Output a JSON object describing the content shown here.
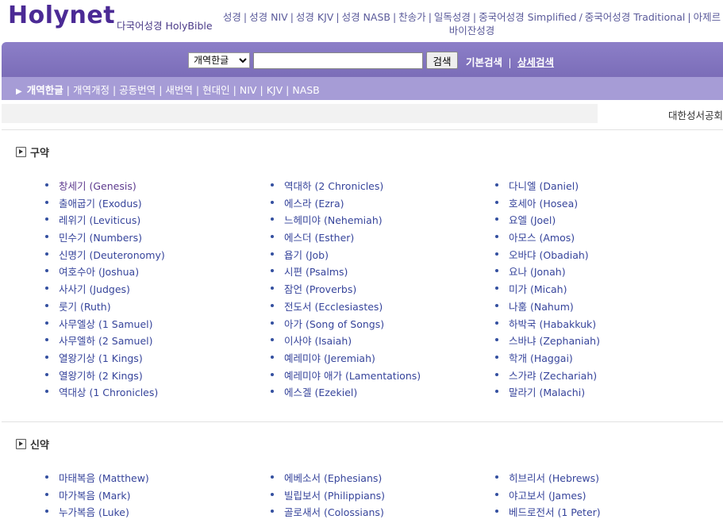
{
  "header": {
    "logo": "Holynet",
    "subtitle": "다국어성경 HolyBible",
    "nav": [
      "성경",
      "성경 NIV",
      "성경 KJV",
      "성경 NASB",
      "찬송가",
      "일독성경",
      "중국어성경 Simplified",
      "중국어성경 Traditional",
      "아제르바이잔성경"
    ]
  },
  "search": {
    "version_selected": "개역한글",
    "input_value": "",
    "button_label": "검색",
    "basic_label": "기본검색",
    "advanced_label": "상세검색"
  },
  "versions": {
    "active": "개역한글",
    "others": [
      "개역개정",
      "공동번역",
      "새번역",
      "현대인",
      "NIV",
      "KJV",
      "NASB"
    ]
  },
  "publisher": "대한성서공회",
  "old_testament": {
    "title": "구약",
    "columns": [
      [
        "창세기 (Genesis)",
        "출애굽기 (Exodus)",
        "레위기 (Leviticus)",
        "민수기 (Numbers)",
        "신명기 (Deuteronomy)",
        "여호수아 (Joshua)",
        "사사기 (Judges)",
        "룻기 (Ruth)",
        "사무엘상 (1 Samuel)",
        "사무엘하 (2 Samuel)",
        "열왕기상 (1 Kings)",
        "열왕기하 (2 Kings)",
        "역대상 (1 Chronicles)"
      ],
      [
        "역대하 (2 Chronicles)",
        "에스라 (Ezra)",
        "느헤미야 (Nehemiah)",
        "에스더 (Esther)",
        "욥기 (Job)",
        "시편 (Psalms)",
        "잠언 (Proverbs)",
        "전도서 (Ecclesiastes)",
        "아가 (Song of Songs)",
        "이사야 (Isaiah)",
        "예레미야 (Jeremiah)",
        "예레미야 애가 (Lamentations)",
        "에스겔 (Ezekiel)"
      ],
      [
        "다니엘 (Daniel)",
        "호세아 (Hosea)",
        "요엘 (Joel)",
        "아모스 (Amos)",
        "오바댜 (Obadiah)",
        "요나 (Jonah)",
        "미가 (Micah)",
        "나훔 (Nahum)",
        "하박국 (Habakkuk)",
        "스바냐 (Zephaniah)",
        "학개 (Haggai)",
        "스가랴 (Zechariah)",
        "말라기 (Malachi)"
      ]
    ]
  },
  "new_testament": {
    "title": "신약",
    "columns": [
      [
        "마태복음 (Matthew)",
        "마가복음 (Mark)",
        "누가복음 (Luke)"
      ],
      [
        "에베소서 (Ephesians)",
        "빌립보서 (Philippians)",
        "골로새서 (Colossians)"
      ],
      [
        "히브리서 (Hebrews)",
        "야고보서 (James)",
        "베드로전서 (1 Peter)"
      ]
    ]
  },
  "colors": {
    "brand": "#4b2a95",
    "search_bar": "#8c7fc8",
    "tab_bar": "#a69cd6",
    "link": "#36449b"
  },
  "icons": {
    "section_toggle": "play-triangle-icon",
    "tab_marker": "caret-right-icon"
  }
}
